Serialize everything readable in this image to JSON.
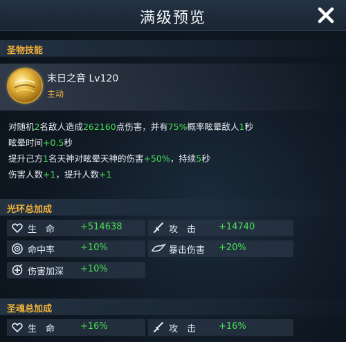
{
  "window": {
    "title": "满级预览"
  },
  "colors": {
    "accent": "#f2b23c",
    "positive": "#47e052",
    "text": "#e9eef5"
  },
  "holy_skill": {
    "section_title": "圣物技能",
    "icon": "golden-orb-icon",
    "name": "末日之音 Lv120",
    "type": "主动",
    "lines": [
      [
        {
          "t": "对随机"
        },
        {
          "t": "2",
          "hl": true
        },
        {
          "t": "名敌人造成"
        },
        {
          "t": "262160",
          "hl": true
        },
        {
          "t": "点伤害，并有"
        },
        {
          "t": "75%",
          "hl": true
        },
        {
          "t": "概率眩晕敌人"
        },
        {
          "t": "1",
          "hl": true
        },
        {
          "t": "秒"
        }
      ],
      [
        {
          "t": "眩晕时间"
        },
        {
          "t": "+0.5",
          "hl": true
        },
        {
          "t": "秒"
        }
      ],
      [
        {
          "t": "提升己方"
        },
        {
          "t": "1",
          "hl": true
        },
        {
          "t": "名天神对眩晕天神的伤害"
        },
        {
          "t": "+50%",
          "hl": true
        },
        {
          "t": "，持续"
        },
        {
          "t": "5",
          "hl": true
        },
        {
          "t": "秒"
        }
      ],
      [
        {
          "t": "伤害人数"
        },
        {
          "t": "+1",
          "hl": true
        },
        {
          "t": "，提升人数"
        },
        {
          "t": "+1",
          "hl": true
        }
      ]
    ]
  },
  "aura": {
    "section_title": "光环总加成",
    "stats": [
      {
        "icon": "heart-icon",
        "label": "生　命",
        "value": "+514638"
      },
      {
        "icon": "sword-icon",
        "label": "攻　击",
        "value": "+14740"
      },
      {
        "icon": "crosshair-icon",
        "label": "命中率",
        "value": "+10%"
      },
      {
        "icon": "critical-icon",
        "label": "暴击伤害",
        "value": "+20%"
      },
      {
        "icon": "damage-boost-icon",
        "label": "伤害加深",
        "value": "+10%"
      }
    ]
  },
  "soul": {
    "section_title": "圣魂总加成",
    "stats": [
      {
        "icon": "heart-icon",
        "label": "生　命",
        "value": "+16%"
      },
      {
        "icon": "sword-icon",
        "label": "攻　击",
        "value": "+16%"
      }
    ]
  }
}
